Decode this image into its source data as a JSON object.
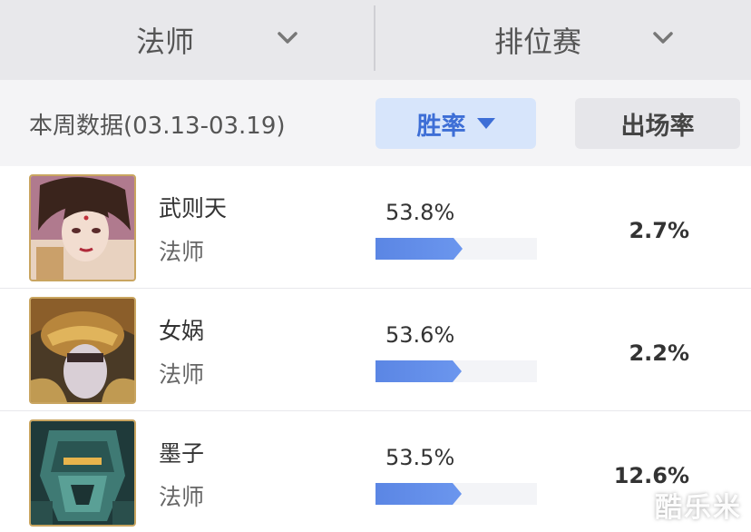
{
  "filters": {
    "class_label": "法师",
    "mode_label": "排位赛"
  },
  "subheader": {
    "week_label": "本周数据(03.13-03.19)",
    "sort_win_rate": "胜率",
    "sort_pick_rate": "出场率"
  },
  "heroes": [
    {
      "name": "武则天",
      "role": "法师",
      "win_rate": "53.8%",
      "win_rate_value": 53.8,
      "pick_rate": "2.7%",
      "icon": "wu-zetian-portrait"
    },
    {
      "name": "女娲",
      "role": "法师",
      "win_rate": "53.6%",
      "win_rate_value": 53.6,
      "pick_rate": "2.2%",
      "icon": "nuwa-portrait"
    },
    {
      "name": "墨子",
      "role": "法师",
      "win_rate": "53.5%",
      "win_rate_value": 53.5,
      "pick_rate": "12.6%",
      "icon": "mozi-portrait"
    }
  ],
  "watermark": "酷乐米",
  "colors": {
    "accent": "#3d6ed6",
    "bar": "#5b86e4",
    "frame_gold": "#c9a560"
  }
}
